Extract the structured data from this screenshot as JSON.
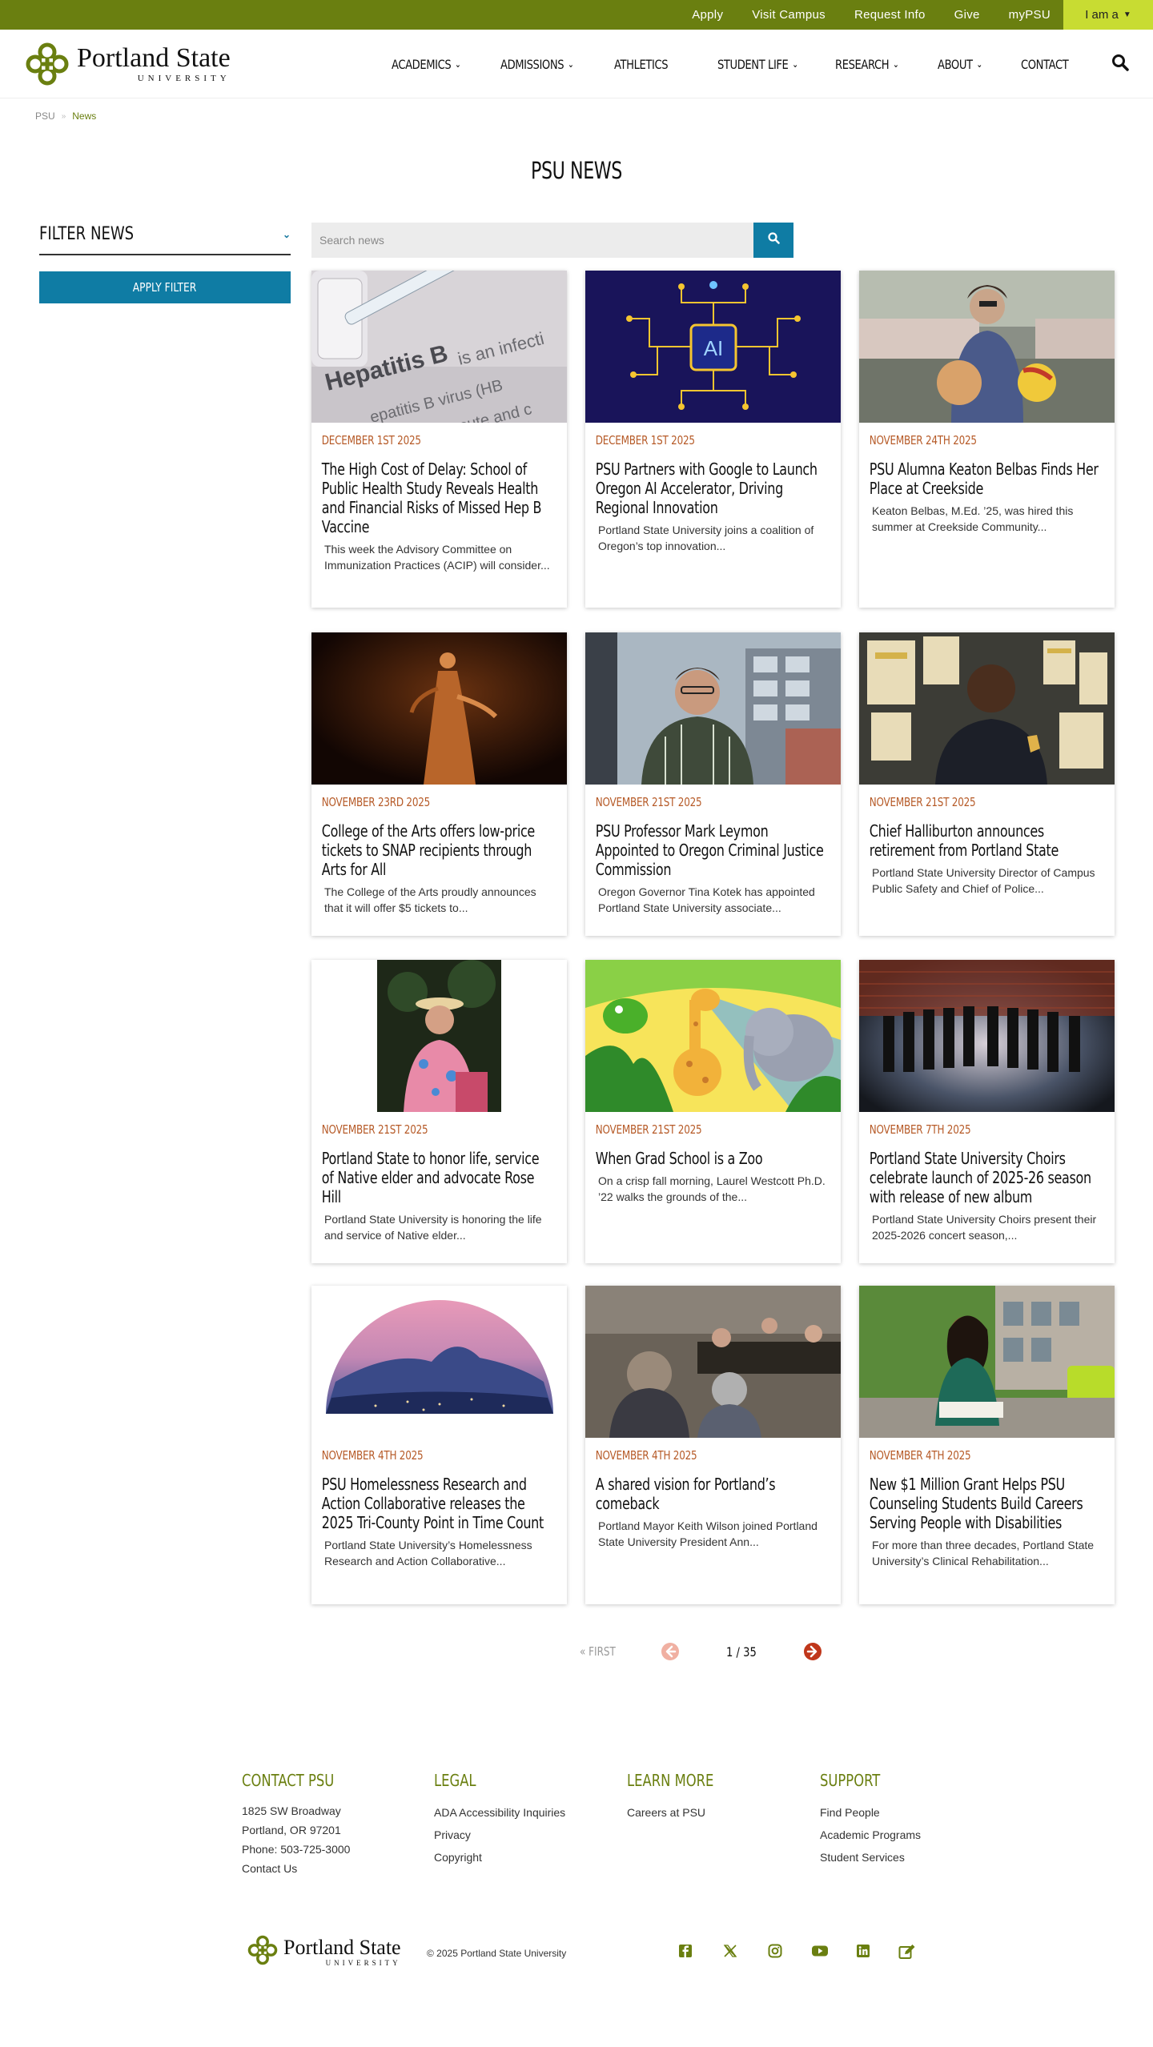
{
  "utility_links": [
    "Apply",
    "Visit Campus",
    "Request Info",
    "Give",
    "myPSU"
  ],
  "iam_label": "I am a",
  "logo": {
    "name": "Portland State",
    "sub": "UNIVERSITY"
  },
  "nav": [
    "ACADEMICS",
    "ADMISSIONS",
    "ATHLETICS",
    "STUDENT LIFE",
    "RESEARCH",
    "ABOUT",
    "CONTACT"
  ],
  "breadcrumb": {
    "root": "PSU",
    "current": "News"
  },
  "page_title": "PSU NEWS",
  "filter": {
    "title": "FILTER NEWS",
    "apply": "APPLY FILTER"
  },
  "search": {
    "placeholder": "Search news"
  },
  "cards": [
    {
      "date": "DECEMBER 1ST 2025",
      "title": "The High Cost of Delay: School of Public Health Study Reveals Health and Financial Risks of Missed Hep B Vaccine",
      "desc": "This week the Advisory Committee on Immunization Practices (ACIP) will consider..."
    },
    {
      "date": "DECEMBER 1ST 2025",
      "title": "PSU Partners with Google to Launch Oregon AI Accelerator, Driving Regional Innovation",
      "desc": "Portland State University joins a coalition of Oregon’s top innovation..."
    },
    {
      "date": "NOVEMBER 24TH 2025",
      "title": "PSU Alumna Keaton Belbas Finds Her Place at Creekside",
      "desc": "Keaton Belbas, M.Ed. ’25, was hired this summer at Creekside Community..."
    },
    {
      "date": "NOVEMBER 23RD 2025",
      "title": "College of the Arts offers low-price tickets to SNAP recipients through Arts for All",
      "desc": "The College of the Arts proudly announces that it will offer $5 tickets to..."
    },
    {
      "date": "NOVEMBER 21ST 2025",
      "title": "PSU Professor Mark Leymon Appointed to Oregon Criminal Justice Commission",
      "desc": "Oregon Governor Tina Kotek has appointed Portland State University associate..."
    },
    {
      "date": "NOVEMBER 21ST 2025",
      "title": "Chief Halliburton announces retirement from Portland State",
      "desc": "Portland State University Director of Campus Public Safety and Chief of Police..."
    },
    {
      "date": "NOVEMBER 21ST 2025",
      "title": "Portland State to honor life, service of Native elder and advocate Rose Hill",
      "desc": "Portland State University is honoring the life and service of Native elder..."
    },
    {
      "date": "NOVEMBER 21ST 2025",
      "title": "When Grad School is a Zoo",
      "desc": "On a crisp fall morning, Laurel Westcott Ph.D. ’22 walks the grounds of the..."
    },
    {
      "date": "NOVEMBER 7TH 2025",
      "title": "Portland State University Choirs celebrate launch of 2025-26 season with release of new album",
      "desc": "Portland State University Choirs present their 2025-2026 concert season,..."
    },
    {
      "date": "NOVEMBER 4TH 2025",
      "title": "PSU Homelessness Research and Action Collaborative releases the 2025 Tri-County Point in Time Count",
      "desc": "Portland State University’s Homelessness Research and Action Collaborative..."
    },
    {
      "date": "NOVEMBER 4TH 2025",
      "title": "A shared vision for Portland’s comeback",
      "desc": "Portland Mayor Keith Wilson joined Portland State University President Ann..."
    },
    {
      "date": "NOVEMBER 4TH 2025",
      "title": "New $1 Million Grant Helps PSU Counseling Students Build Careers Serving People with Disabilities",
      "desc": "For more than three decades, Portland State University’s Clinical Rehabilitation..."
    }
  ],
  "pager": {
    "first": "« FIRST",
    "count": "1 / 35"
  },
  "footer": {
    "contact": {
      "title": "CONTACT PSU",
      "address1": "1825 SW Broadway",
      "address2": "Portland, OR 97201",
      "phone": "Phone: 503-725-3000",
      "link": "Contact Us"
    },
    "legal": {
      "title": "LEGAL",
      "links": [
        "ADA Accessibility Inquiries",
        "Privacy",
        "Copyright"
      ]
    },
    "learn": {
      "title": "LEARN MORE",
      "links": [
        "Careers at PSU"
      ]
    },
    "support": {
      "title": "SUPPORT",
      "links": [
        "Find People",
        "Academic Programs",
        "Student Services"
      ]
    },
    "copyright": "© 2025 Portland State University"
  },
  "colors": {
    "olive": "#6a7f10",
    "lime": "#c8dc32",
    "blue": "#0f7ca4",
    "date_orange": "#b65a27",
    "pager_red": "#c0371b"
  },
  "icons": [
    "search-icon",
    "facebook-icon",
    "x-icon",
    "instagram-icon",
    "youtube-icon",
    "linkedin-icon",
    "edit-icon"
  ]
}
